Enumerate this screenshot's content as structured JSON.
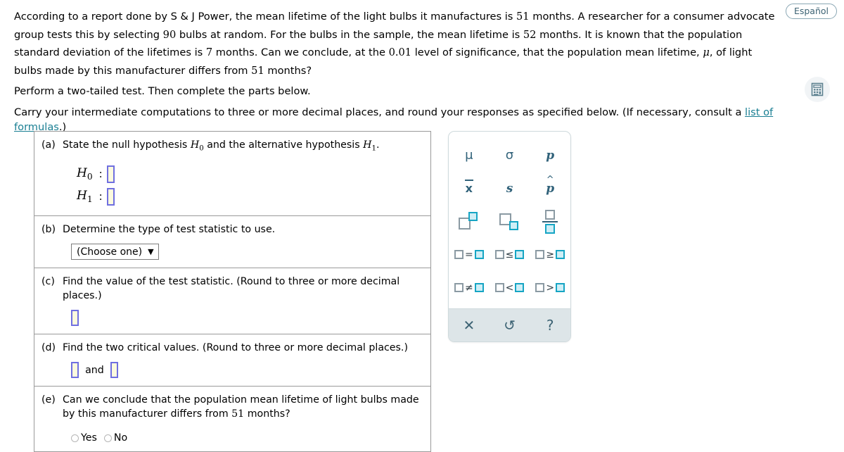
{
  "top_controls": {
    "espanol_label": "Español",
    "calculator_icon": "calculator-icon"
  },
  "problem": {
    "sentence_1a": "According to a report done by S & J Power, the mean lifetime of the light bulbs it manufactures is ",
    "population_mean": "51",
    "sentence_1b": " months. A researcher for a consumer advocate group tests this by selecting ",
    "sample_size": "90",
    "sentence_1c": " bulbs at random. For the bulbs in the sample, the mean lifetime is ",
    "sample_mean": "52",
    "sentence_1d": " months. It is known that the population standard deviation of the lifetimes is ",
    "population_sd": "7",
    "sentence_1e": " months. Can we conclude, at the ",
    "significance_level": "0.01",
    "sentence_1f": " level of significance, that the population mean lifetime, ",
    "mu_symbol": "μ",
    "sentence_1g": ", of light bulbs made by this manufacturer differs from ",
    "sentence_1h": " months?",
    "perform_line": "Perform a two-tailed test. Then complete the parts below.",
    "carry_line_a": "Carry your intermediate computations to three or more decimal places, and round your responses as specified below. (If necessary, consult a ",
    "formula_link": "list of formulas",
    "carry_line_b": ".)"
  },
  "parts": {
    "a": {
      "label": "(a)",
      "text_1": "State the null hypothesis ",
      "h0": "H",
      "h0_sub": "0",
      "text_2": " and the alternative hypothesis ",
      "h1": "H",
      "h1_sub": "1",
      "text_3": ".",
      "row_h0_name": "H",
      "row_h0_sub": "0",
      "row_h1_name": "H",
      "row_h1_sub": "1",
      "colon": ":",
      "input_value": ""
    },
    "b": {
      "label": "(b)",
      "text": "Determine the type of test statistic to use.",
      "select_value": "(Choose one)",
      "select_caret": "▼"
    },
    "c": {
      "label": "(c)",
      "text": "Find the value of the test statistic. (Round to three or more decimal places.)",
      "input_value": ""
    },
    "d": {
      "label": "(d)",
      "text": "Find the two critical values. (Round to three or more decimal places.)",
      "conjunction": "and",
      "input_value_1": "",
      "input_value_2": ""
    },
    "e": {
      "label": "(e)",
      "text_1": "Can we conclude that the population mean lifetime of light bulbs made by this manufacturer differs from ",
      "value": "51",
      "text_2": " months?",
      "option_yes": "Yes",
      "option_no": "No",
      "selected": ""
    }
  },
  "palette": {
    "symbols": {
      "mu": "μ",
      "sigma": "σ",
      "p": "p",
      "xbar": "x",
      "s": "s",
      "phat": "p",
      "phat_hat": "^"
    },
    "operators": {
      "equals": "=",
      "leq": "≤",
      "geq": "≥",
      "neq": "≠",
      "lt": "<",
      "gt": ">"
    },
    "footer": {
      "close": "✕",
      "undo": "↺",
      "help": "?"
    }
  },
  "colors": {
    "link": "#1a7f93",
    "input_border": "#6f6fe0",
    "input_fill": "#fcfade",
    "palette_text": "#31627a",
    "palette_teal": "#16a5c4",
    "palette_gray": "#8b9aa3",
    "palette_footer_bg": "#dde5e8"
  }
}
